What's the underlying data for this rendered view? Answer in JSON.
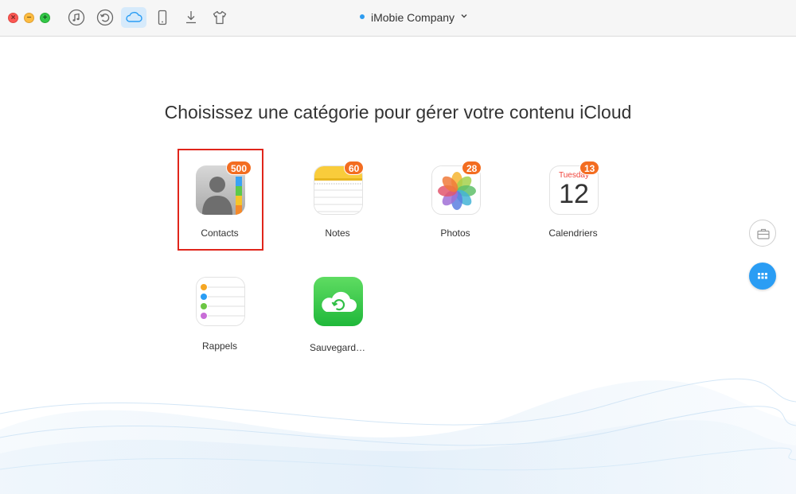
{
  "toolbar": {
    "icons": [
      "music-note-icon",
      "restore-icon",
      "icloud-icon",
      "phone-icon",
      "download-icon",
      "tshirt-icon"
    ],
    "active_icon": "icloud-icon"
  },
  "device": {
    "name": "iMobie Company",
    "status_color": "#2d9cf0"
  },
  "main": {
    "heading": "Choisissez une catégorie pour gérer votre contenu iCloud"
  },
  "categories": [
    {
      "label": "Contacts",
      "count": "500",
      "icon": "contacts-icon",
      "selected": true
    },
    {
      "label": "Notes",
      "count": "60",
      "icon": "notes-icon"
    },
    {
      "label": "Photos",
      "count": "28",
      "icon": "photos-icon"
    },
    {
      "label": "Calendriers",
      "count": "13",
      "icon": "calendar-icon",
      "calendar_day_name": "Tuesday",
      "calendar_day_number": "12"
    },
    {
      "label": "Rappels",
      "icon": "reminders-icon"
    },
    {
      "label": "Sauvegard…",
      "icon": "backup-icon"
    }
  ],
  "colors": {
    "accent": "#2a9df4",
    "badge": "#f36d21",
    "selection": "#e0251b"
  }
}
